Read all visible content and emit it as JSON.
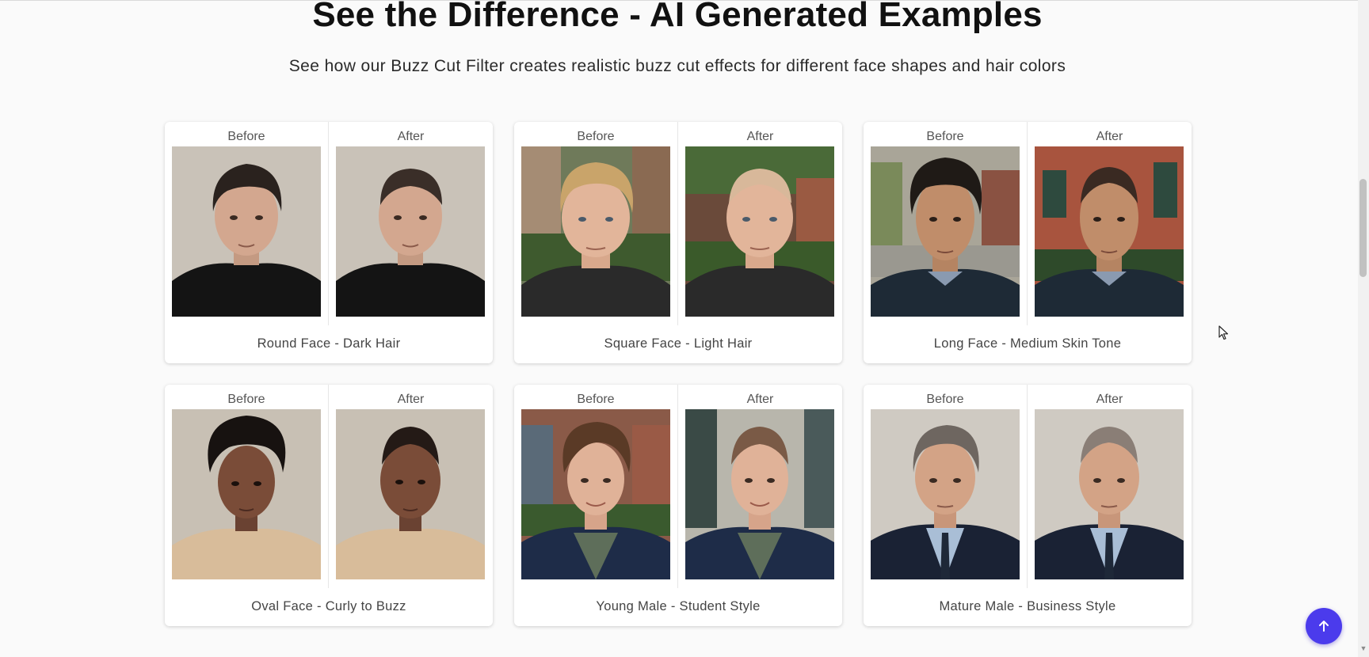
{
  "header": {
    "title": "See the Difference - AI Generated Examples",
    "subtitle": "See how our Buzz Cut Filter creates realistic buzz cut effects for different face shapes and hair colors"
  },
  "labels": {
    "before": "Before",
    "after": "After"
  },
  "examples": [
    {
      "caption": "Round Face - Dark Hair"
    },
    {
      "caption": "Square Face - Light Hair"
    },
    {
      "caption": "Long Face - Medium Skin Tone"
    },
    {
      "caption": "Oval Face - Curly to Buzz"
    },
    {
      "caption": "Young Male - Student Style"
    },
    {
      "caption": "Mature Male - Business Style"
    }
  ],
  "colors": {
    "accent": "#4b3bec",
    "page_background": "#fafafa",
    "card_background": "#ffffff"
  },
  "icons": {
    "back_to_top": "arrow-up-icon",
    "cursor": "mouse-pointer-icon"
  }
}
